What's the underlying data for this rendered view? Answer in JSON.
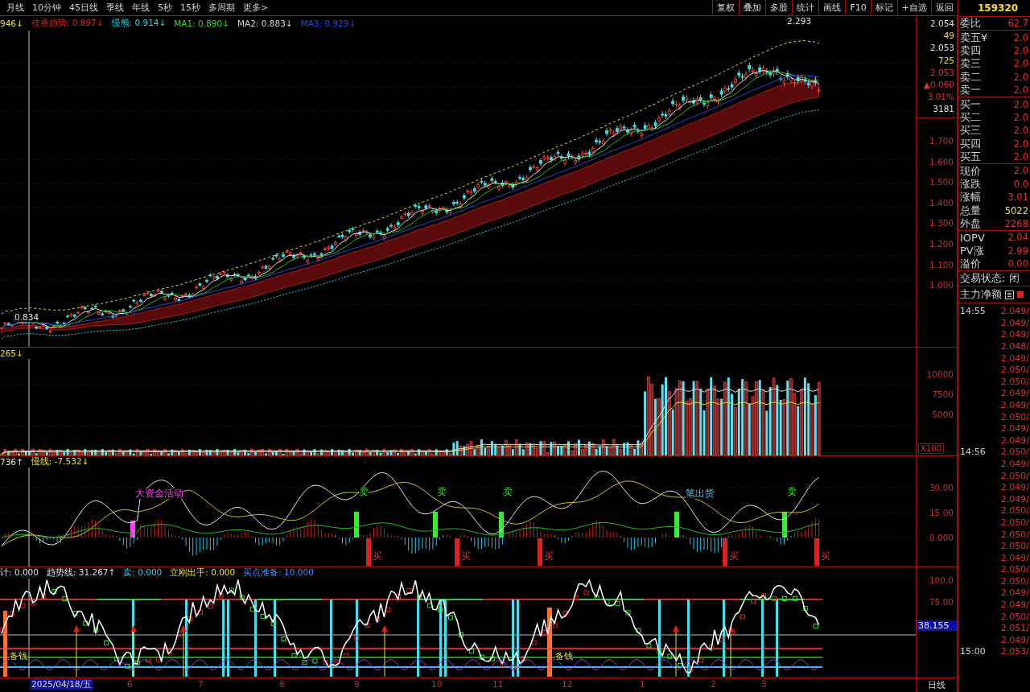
{
  "toolbar": {
    "periods": [
      "月线",
      "10分钟",
      "45日线",
      "季线",
      "年线",
      "5秒",
      "15秒",
      "多周期",
      "更多>"
    ],
    "buttons": [
      "复权",
      "叠加",
      "多股",
      "统计",
      "画线",
      "F10",
      "标记",
      "+自选",
      "返回"
    ]
  },
  "main_pane": {
    "legend": [
      {
        "text": "946↓",
        "color": "#e8e030"
      },
      {
        "text": "佳睿趋势: 0.897↓",
        "color": "#e02020"
      },
      {
        "text": "慢熊: 0.914↓",
        "color": "#30d0e0"
      },
      {
        "text": "MA1: 0.890↓",
        "color": "#20e020"
      },
      {
        "text": "MA2: 0.883↓",
        "color": "#d0d0d0"
      },
      {
        "text": "MA3: 0.929↓",
        "color": "#3040e0"
      }
    ],
    "high_label": "2.293",
    "low_label": "0.834",
    "info_box": [
      {
        "text": "2.054",
        "color": "#e0e0e0"
      },
      {
        "text": "49",
        "color": "#e8e030"
      },
      {
        "text": "2.053",
        "color": "#e0e0e0"
      },
      {
        "text": "725",
        "color": "#e8e030"
      },
      {
        "text": "2.053",
        "color": "#e03030"
      },
      {
        "text": "▲0.060",
        "color": "#e03030"
      },
      {
        "text": "3.01%",
        "color": "#e03030"
      },
      {
        "text": "3181",
        "color": "#e0e0e0"
      }
    ],
    "axis": [
      "1.700",
      "1.600",
      "1.500",
      "1.400",
      "1.300",
      "1.200",
      "1.100",
      "1.000"
    ]
  },
  "volume_pane": {
    "legend": [
      {
        "text": "265↓",
        "color": "#e8e030"
      }
    ],
    "axis": [
      "10000",
      "7500",
      "5000"
    ],
    "unit": "X100"
  },
  "signal_pane": {
    "legend": [
      {
        "text": "736↑",
        "color": "#e0e0e0"
      },
      {
        "text": "慢线: -7.532↓",
        "color": "#e8e030"
      }
    ],
    "axis": [
      "30.00",
      "15.00",
      "0.000"
    ],
    "labels": [
      {
        "text": "大资金活动",
        "kind": "note"
      },
      {
        "text": "卖",
        "kind": "sell"
      },
      {
        "text": "卖",
        "kind": "sell"
      },
      {
        "text": "卖",
        "kind": "sell"
      },
      {
        "text": "笔出货",
        "kind": "note2"
      },
      {
        "text": "卖",
        "kind": "sell"
      },
      {
        "text": "买",
        "kind": "buy"
      },
      {
        "text": "买",
        "kind": "buy"
      },
      {
        "text": "买",
        "kind": "buy"
      },
      {
        "text": "买",
        "kind": "buy"
      },
      {
        "text": "买",
        "kind": "buy"
      }
    ]
  },
  "trend_pane": {
    "legend": [
      {
        "text": "计: 0.000",
        "color": "#e0e0e0"
      },
      {
        "text": "趋势线: 31.267↑",
        "color": "#e0e0e0"
      },
      {
        "text": "卖: 0.000",
        "color": "#30d0e0"
      },
      {
        "text": "立刚出手: 0.000",
        "color": "#e8e030"
      },
      {
        "text": "买点准备: 10.000",
        "color": "#4090ff"
      }
    ],
    "axis": [
      "100.0",
      "75.00"
    ],
    "current": "38.155",
    "labels": [
      "备钱",
      "备钱"
    ]
  },
  "date_axis": {
    "dates": [
      "2025/04/18/五",
      "6",
      "7",
      "8",
      "9",
      "10",
      "11",
      "12",
      "1",
      "2",
      "3"
    ],
    "period": "日线"
  },
  "quote": {
    "code": "159320",
    "ratio_label": "委比",
    "ratio_value": "62.7",
    "asks": [
      {
        "label": "卖五¥",
        "value": "2.0"
      },
      {
        "label": "卖四",
        "value": "2.0"
      },
      {
        "label": "卖三",
        "value": "2.0"
      },
      {
        "label": "卖二",
        "value": "2.0"
      },
      {
        "label": "卖一",
        "value": "2.0"
      }
    ],
    "bids": [
      {
        "label": "买一",
        "value": "2.0"
      },
      {
        "label": "买二",
        "value": "2.0"
      },
      {
        "label": "买三",
        "value": "2.0"
      },
      {
        "label": "买四",
        "value": "2.0"
      },
      {
        "label": "买五",
        "value": "2.0"
      }
    ],
    "stats": [
      {
        "label": "现价",
        "value": "2.0",
        "color": "#e03030"
      },
      {
        "label": "涨跌",
        "value": "0.0",
        "color": "#e03030"
      },
      {
        "label": "涨幅",
        "value": "3.01",
        "color": "#e03030"
      },
      {
        "label": "总量",
        "value": "5022",
        "color": "#e8e030"
      },
      {
        "label": "外盘",
        "value": "2268",
        "color": "#e03030"
      }
    ],
    "iopv": [
      {
        "label": "IOPV",
        "value": "2.04"
      },
      {
        "label": "PV涨",
        "value": "2.99"
      },
      {
        "label": "溢价",
        "value": "0.00"
      }
    ],
    "status": "交易状态: 闭",
    "flow_label": "主力净额",
    "ticks": [
      {
        "time": "14:55",
        "price": "2.049/"
      },
      {
        "price": "2.049/"
      },
      {
        "price": "2.049/"
      },
      {
        "price": "2.048/"
      },
      {
        "price": "2.049/"
      },
      {
        "price": "2.050/"
      },
      {
        "price": "2.050/"
      },
      {
        "price": "2.049/"
      },
      {
        "price": "2.049/"
      },
      {
        "price": "2.050/"
      },
      {
        "price": "2.049/"
      },
      {
        "price": "2.049/"
      },
      {
        "time": "14:56",
        "price": "2.050/"
      },
      {
        "price": "2.049/"
      },
      {
        "price": "2.050/"
      },
      {
        "price": "2.049/"
      },
      {
        "price": "2.049/"
      },
      {
        "price": "2.050/"
      },
      {
        "price": "2.050/"
      },
      {
        "price": "2.050/"
      },
      {
        "price": "2.050/"
      },
      {
        "price": "2.049/"
      },
      {
        "price": "2.050/"
      },
      {
        "price": "2.050/"
      },
      {
        "price": "2.049/"
      },
      {
        "price": "2.049/"
      },
      {
        "price": "2.050/"
      },
      {
        "price": "2.051/"
      },
      {
        "price": "2.049/"
      },
      {
        "time": "15:00",
        "price": "2.053/"
      }
    ]
  }
}
